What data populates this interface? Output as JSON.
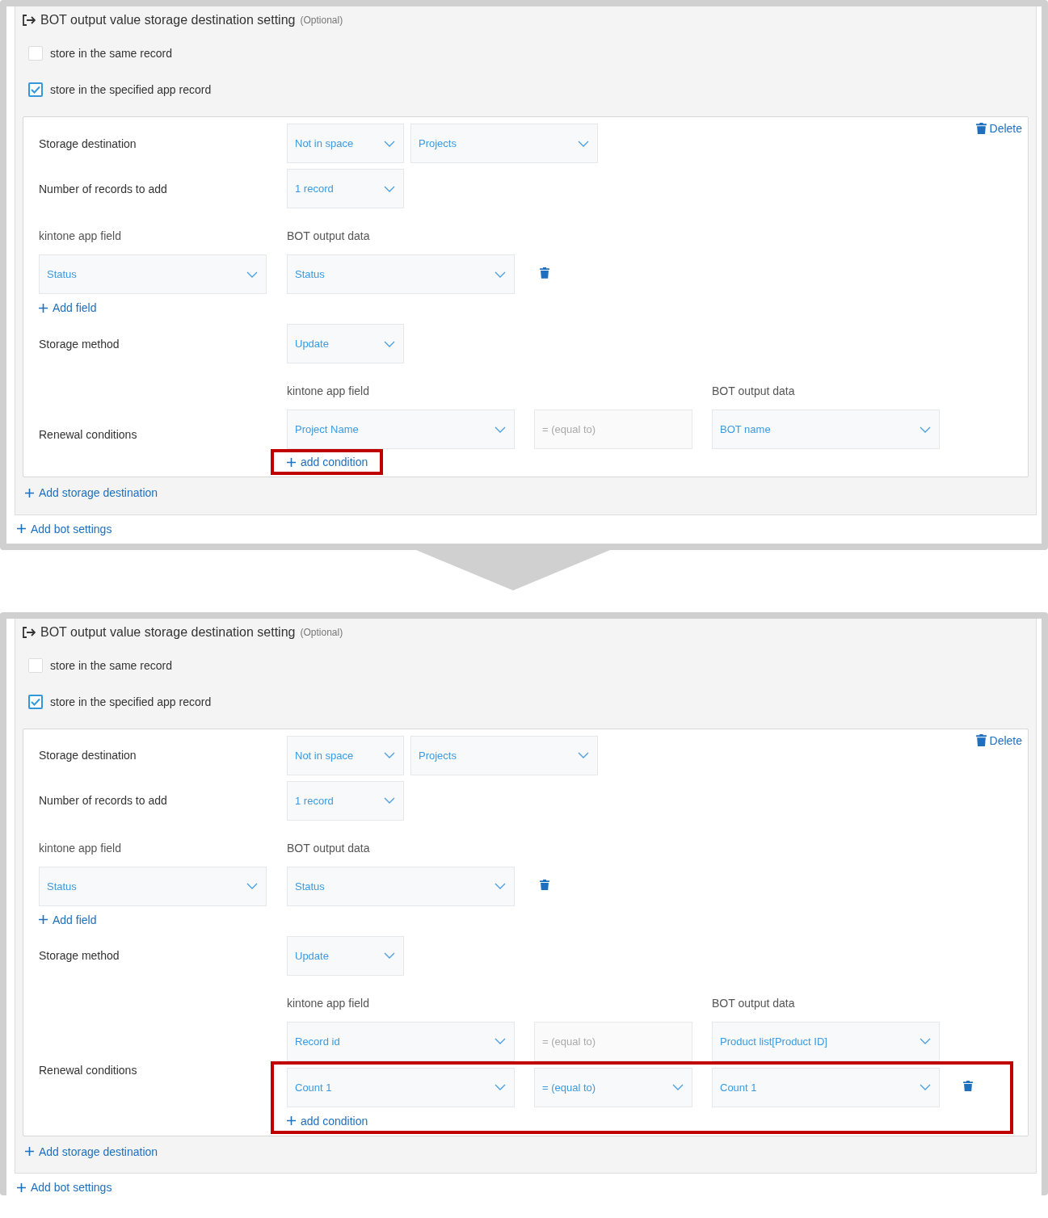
{
  "panels": [
    {
      "title": "BOT output value storage destination setting",
      "optional": "(Optional)",
      "options": [
        {
          "label": "store in the same record",
          "checked": false
        },
        {
          "label": "store in the specified app record",
          "checked": true
        }
      ],
      "destination": {
        "delete": "Delete",
        "rows": [
          {
            "label": "Storage destination",
            "selects": [
              "Not in space",
              "Projects"
            ]
          },
          {
            "label": "Number of records to add",
            "selects": [
              "1 record"
            ]
          }
        ],
        "mapping": {
          "field_header": "kintone app field",
          "bot_header": "BOT output data",
          "rows": [
            {
              "field": "Status",
              "bot": "Status"
            }
          ],
          "add": "Add field"
        },
        "method": {
          "label": "Storage method",
          "selects": [
            "Update"
          ]
        },
        "conditions": {
          "label": "Renewal conditions",
          "field_header": "kintone app field",
          "bot_header": "BOT output data",
          "rows": [
            {
              "field": "Project Name",
              "operator": {
                "kind": "text",
                "value": "= (equal to)"
              },
              "bot": "BOT name",
              "deletable": false,
              "highlighted": false
            }
          ],
          "add": {
            "label": "add condition",
            "highlighted": true
          }
        }
      },
      "add_destination": "Add storage destination",
      "add_bot": "Add bot settings"
    },
    {
      "title": "BOT output value storage destination setting",
      "optional": "(Optional)",
      "options": [
        {
          "label": "store in the same record",
          "checked": false
        },
        {
          "label": "store in the specified app record",
          "checked": true
        }
      ],
      "destination": {
        "delete": "Delete",
        "rows": [
          {
            "label": "Storage destination",
            "selects": [
              "Not in space",
              "Projects"
            ]
          },
          {
            "label": "Number of records to add",
            "selects": [
              "1 record"
            ]
          }
        ],
        "mapping": {
          "field_header": "kintone app field",
          "bot_header": "BOT output data",
          "rows": [
            {
              "field": "Status",
              "bot": "Status"
            }
          ],
          "add": "Add field"
        },
        "method": {
          "label": "Storage method",
          "selects": [
            "Update"
          ]
        },
        "conditions": {
          "label": "Renewal conditions",
          "field_header": "kintone app field",
          "bot_header": "BOT output data",
          "rows": [
            {
              "field": "Record id",
              "operator": {
                "kind": "text",
                "value": "= (equal to)"
              },
              "bot": "Product list[Product ID]",
              "deletable": false,
              "highlighted": false
            },
            {
              "field": "Count 1",
              "operator": {
                "kind": "select",
                "value": "= (equal to)"
              },
              "bot": "Count 1",
              "deletable": true,
              "highlighted": true
            }
          ],
          "add": {
            "label": "add condition",
            "highlighted": true
          }
        }
      },
      "add_destination": "Add storage destination",
      "add_bot": "Add bot settings"
    }
  ]
}
